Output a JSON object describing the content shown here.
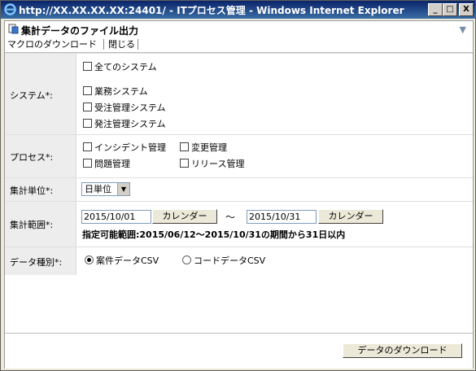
{
  "window": {
    "title": "http://XX.XX.XX.XX:24401/ - ITプロセス管理 - Windows Internet Explorer",
    "min": "_",
    "max": "□",
    "close": "X"
  },
  "dialog": {
    "title": "集計データのファイル出力"
  },
  "menu": {
    "macro_download": "マクロのダウンロード",
    "close": "閉じる"
  },
  "form": {
    "system": {
      "label": "システム*:",
      "all": "全てのシステム",
      "options": [
        "業務システム",
        "受注管理システム",
        "発注管理システム"
      ]
    },
    "process": {
      "label": "プロセス*:",
      "options": [
        "インシデント管理",
        "変更管理",
        "問題管理",
        "リリース管理"
      ]
    },
    "unit": {
      "label": "集計単位*:",
      "value": "日単位"
    },
    "range": {
      "label": "集計範囲*:",
      "from": "2015/10/01",
      "to": "2015/10/31",
      "calendar": "カレンダー",
      "tilde": "～",
      "note": "指定可能範囲:2015/06/12～2015/10/31の期間から31日以内"
    },
    "datatype": {
      "label": "データ種別*:",
      "options": [
        "案件データCSV",
        "コードデータCSV"
      ],
      "selected": 0
    }
  },
  "footer": {
    "download": "データのダウンロード"
  }
}
